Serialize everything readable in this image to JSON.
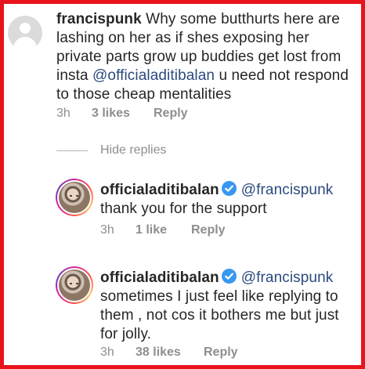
{
  "comments": [
    {
      "username": "francispunk",
      "text_pre": " Why some butthurts here are lashing on her as if shes exposing her private parts grow up buddies get lost from insta ",
      "mention": "@officialaditibalan",
      "text_post": " u need not respond to those cheap mentalities",
      "time": "3h",
      "likes": "3 likes",
      "reply": "Reply"
    }
  ],
  "hide_replies_label": "Hide replies",
  "replies": [
    {
      "username": "officialaditibalan",
      "mention": "@francispunk",
      "text": "thank you for the support",
      "time": "3h",
      "likes": "1 like",
      "reply": "Reply"
    },
    {
      "username": "officialaditibalan",
      "mention": "@francispunk",
      "text": "sometimes I just feel like replying to them , not cos it bothers me but just for jolly.",
      "time": "3h",
      "likes": "38 likes",
      "reply": "Reply"
    }
  ],
  "colors": {
    "frame": "#e8141c",
    "mention": "#2c4a7e",
    "verified": "#3897f0",
    "meta": "#8e8e8e"
  }
}
